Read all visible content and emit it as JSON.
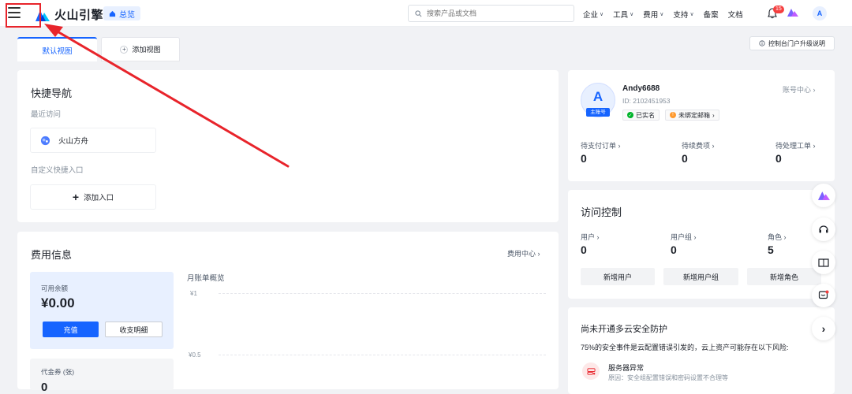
{
  "topbar": {
    "logo_text": "火山引擎",
    "overview_tab": "总览",
    "search_placeholder": "搜索产品或文档",
    "nav": [
      "企业",
      "工具",
      "费用",
      "支持",
      "备案",
      "文档"
    ],
    "notification_count": "15",
    "avatar_letter": "A"
  },
  "view_tabs": {
    "default_view": "默认视图",
    "add_view": "添加视图",
    "upgrade_notice": "控制台门户升级说明"
  },
  "quick_nav": {
    "title": "快捷导航",
    "recent_label": "最近访问",
    "recent_item": "火山方舟",
    "custom_label": "自定义快捷入口",
    "add_entry": "添加入口"
  },
  "billing": {
    "title": "费用信息",
    "center_link": "费用中心",
    "balance_label": "可用余额",
    "balance_value": "¥0.00",
    "recharge": "充值",
    "details": "收支明细",
    "coupon_label": "代金券 (张)",
    "coupon_value": "0",
    "monthly_title": "月账单概览",
    "y_ticks": [
      "¥1",
      "¥0.5"
    ]
  },
  "account": {
    "avatar_letter": "A",
    "role": "主账号",
    "username": "Andy6688",
    "id_text": "ID: 2102451953",
    "center_link": "账号中心",
    "verified": "已实名",
    "email_unbound": "未绑定邮箱",
    "stats": [
      {
        "label": "待支付订单",
        "value": "0"
      },
      {
        "label": "待续费项",
        "value": "0"
      },
      {
        "label": "待处理工单",
        "value": "0"
      }
    ]
  },
  "access": {
    "title": "访问控制",
    "stats": [
      {
        "label": "用户",
        "value": "0"
      },
      {
        "label": "用户组",
        "value": "0"
      },
      {
        "label": "角色",
        "value": "5"
      }
    ],
    "buttons": [
      "新增用户",
      "新增用户组",
      "新增角色"
    ]
  },
  "security": {
    "title": "尚未开通多云安全防护",
    "desc": "75%的安全事件是云配置错误引发的，云上资产可能存在以下风险:",
    "item_title": "服务器异常",
    "item_desc": "原因：安全组配置错误和密码设置不合理等"
  },
  "colors": {
    "primary": "#1664ff",
    "annotation": "#e8242b",
    "background": "#f1f2f5"
  }
}
